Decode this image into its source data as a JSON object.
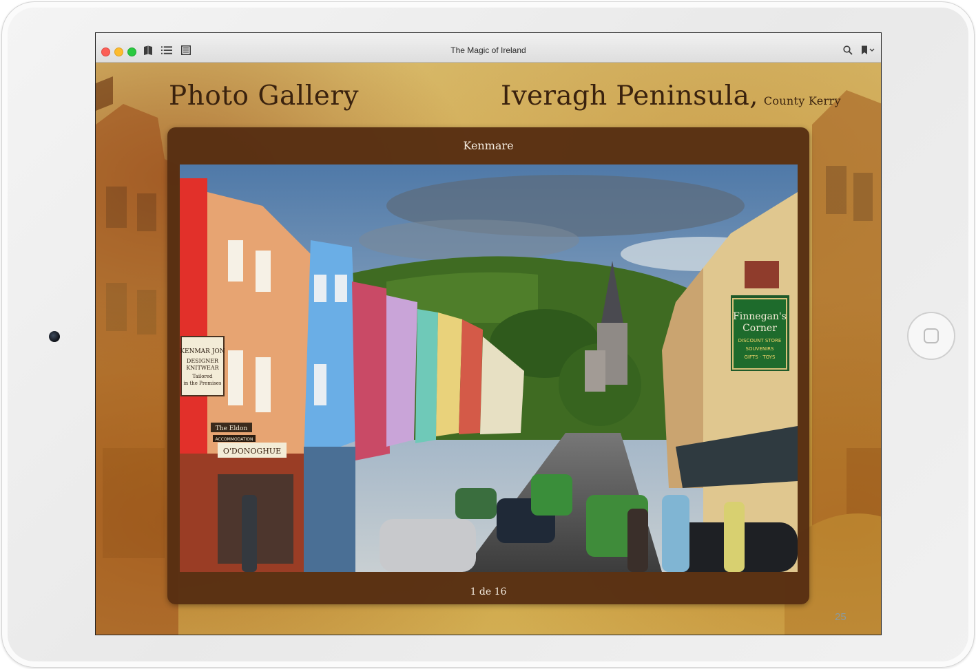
{
  "window": {
    "title": "The Magic of Ireland",
    "icons": [
      "book-icon",
      "list-icon",
      "page-icon",
      "search-icon",
      "bookmark-icon"
    ]
  },
  "page": {
    "left_heading": "Photo Gallery",
    "right_heading": "Iveragh Peninsula,",
    "right_subheading": "County Kerry",
    "page_number": "25"
  },
  "gallery": {
    "caption": "Kenmare",
    "counter": "1 de 16",
    "current_index": 1,
    "total": 16
  },
  "photo_signs": {
    "shop_left": [
      "KENMAR JON",
      "DESIGNER",
      "KNITWEAR",
      "Tailored",
      "in the Premises"
    ],
    "the_eldon": "The Eldon",
    "accommodation": "ACCOMMODATION",
    "odonoghue": "O'DONOGHUE",
    "finnegans": [
      "Finnegan's",
      "Corner"
    ],
    "finnegans_sub": [
      "DISCOUNT STORE",
      "SOUVENIRS",
      "GIFTS · TOYS"
    ]
  },
  "colors": {
    "frame": "#562e12",
    "heading": "#3a220e",
    "caption": "#f4ece0"
  }
}
